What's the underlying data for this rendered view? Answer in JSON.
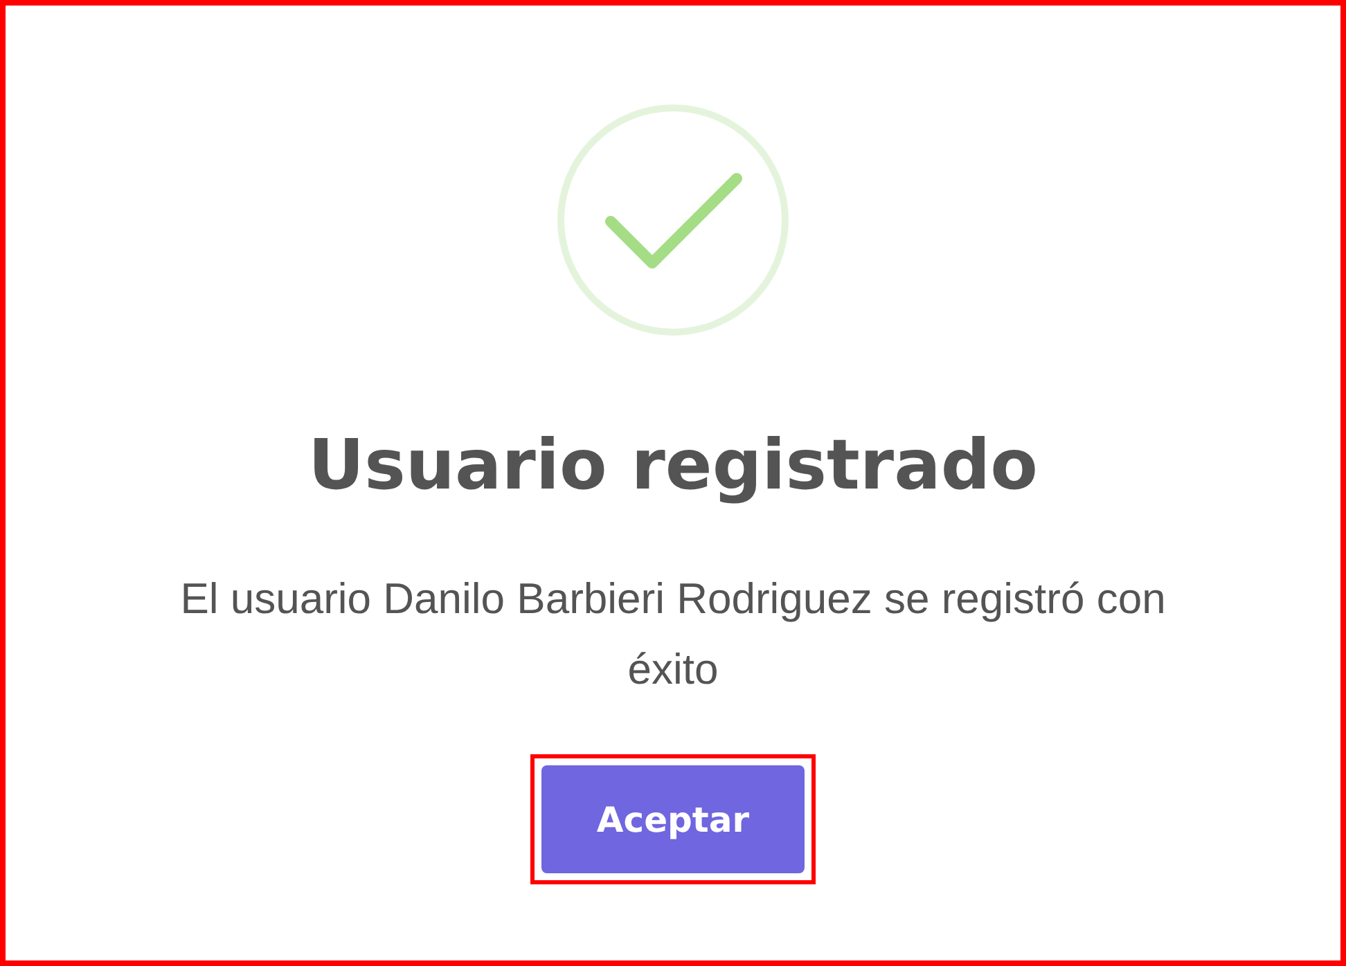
{
  "dialog": {
    "highlighted": true,
    "kind": "success",
    "title": "Usuario registrado",
    "message": "El usuario Danilo Barbieri Rodriguez se registró con éxito",
    "button": {
      "label": "Aceptar",
      "highlighted": true
    }
  }
}
